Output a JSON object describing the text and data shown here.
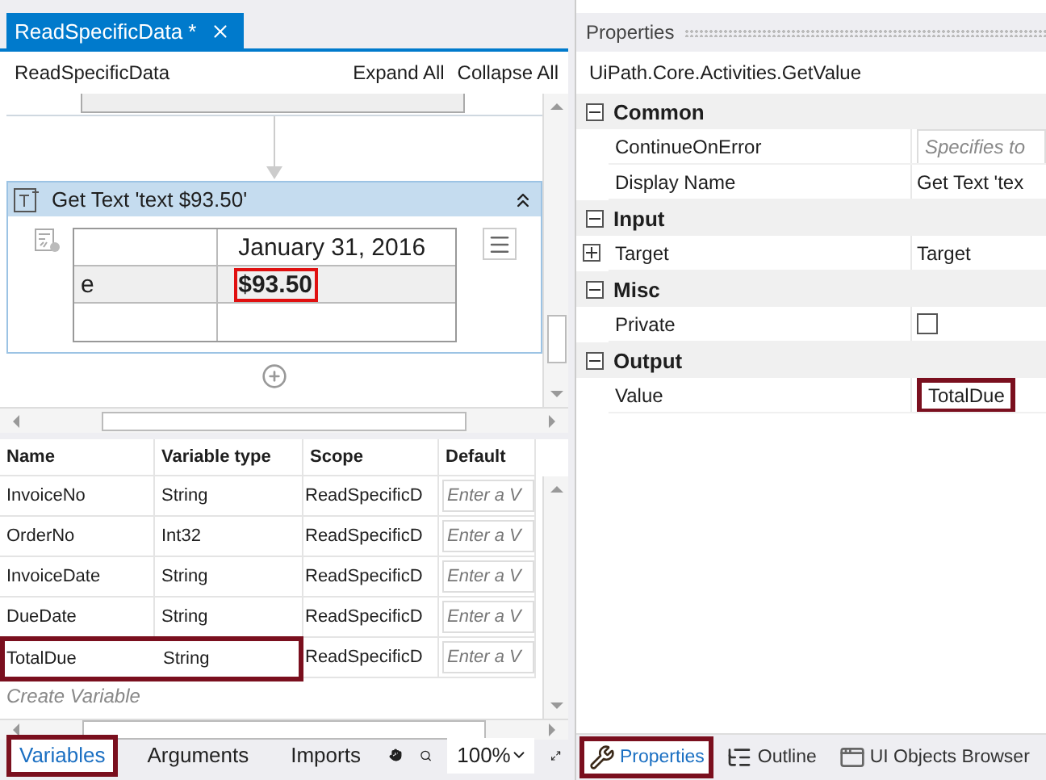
{
  "document_tab": {
    "label": "ReadSpecificData *",
    "selected": true
  },
  "breadcrumb": "ReadSpecificData",
  "expand_all": "Expand All",
  "collapse_all": "Collapse All",
  "activity": {
    "title": "Get Text 'text  $93.50'",
    "expanded": true,
    "preview_rows": [
      {
        "column_1": "",
        "column_2": "January 31, 2016",
        "highlighted": false
      },
      {
        "column_1": "e",
        "column_2": "$93.50",
        "highlighted": true
      },
      {
        "column_1": "",
        "column_2": "",
        "highlighted": false
      }
    ]
  },
  "variables": {
    "columns": [
      "Name",
      "Variable type",
      "Scope",
      "Default"
    ],
    "rows": [
      {
        "name": "InvoiceNo",
        "type": "String",
        "scope": "ReadSpecificD",
        "default_placeholder": "Enter a V",
        "highlighted": false
      },
      {
        "name": "OrderNo",
        "type": "Int32",
        "scope": "ReadSpecificD",
        "default_placeholder": "Enter a V",
        "highlighted": false
      },
      {
        "name": "InvoiceDate",
        "type": "String",
        "scope": "ReadSpecificD",
        "default_placeholder": "Enter a V",
        "highlighted": false
      },
      {
        "name": "DueDate",
        "type": "String",
        "scope": "ReadSpecificD",
        "default_placeholder": "Enter a V",
        "highlighted": false
      },
      {
        "name": "TotalDue",
        "type": "String",
        "scope": "ReadSpecificD",
        "default_placeholder": "Enter a V",
        "highlighted": true
      }
    ],
    "create_label": "Create Variable"
  },
  "bottom_tabs": [
    {
      "label": "Variables",
      "selected": true,
      "highlighted": true
    },
    {
      "label": "Arguments",
      "selected": false,
      "highlighted": false
    },
    {
      "label": "Imports",
      "selected": false,
      "highlighted": false
    }
  ],
  "zoom": "100%",
  "properties": {
    "title": "Properties",
    "class_name": "UiPath.Core.Activities.GetValue",
    "categories": [
      {
        "name": "Common",
        "expanded": true,
        "items": [
          {
            "kind": "field",
            "name": "ContinueOnError",
            "placeholder": "Specifies to",
            "highlighted": false
          },
          {
            "kind": "text",
            "name": "Display Name",
            "value": "Get Text 'tex"
          }
        ]
      },
      {
        "name": "Input",
        "expanded": true,
        "items": [
          {
            "kind": "expandable",
            "name": "Target",
            "value": "Target",
            "expanded": false
          }
        ]
      },
      {
        "name": "Misc",
        "expanded": true,
        "items": [
          {
            "kind": "checkbox",
            "name": "Private",
            "checked": false
          }
        ]
      },
      {
        "name": "Output",
        "expanded": true,
        "items": [
          {
            "kind": "field",
            "name": "Value",
            "value": "TotalDue",
            "highlighted": true
          }
        ]
      }
    ]
  },
  "panel_tabs": [
    {
      "label": "Properties",
      "selected": true,
      "highlighted": true
    },
    {
      "label": "Outline",
      "selected": false,
      "highlighted": false
    },
    {
      "label": "UI Objects Browser",
      "selected": false,
      "highlighted": false
    }
  ]
}
